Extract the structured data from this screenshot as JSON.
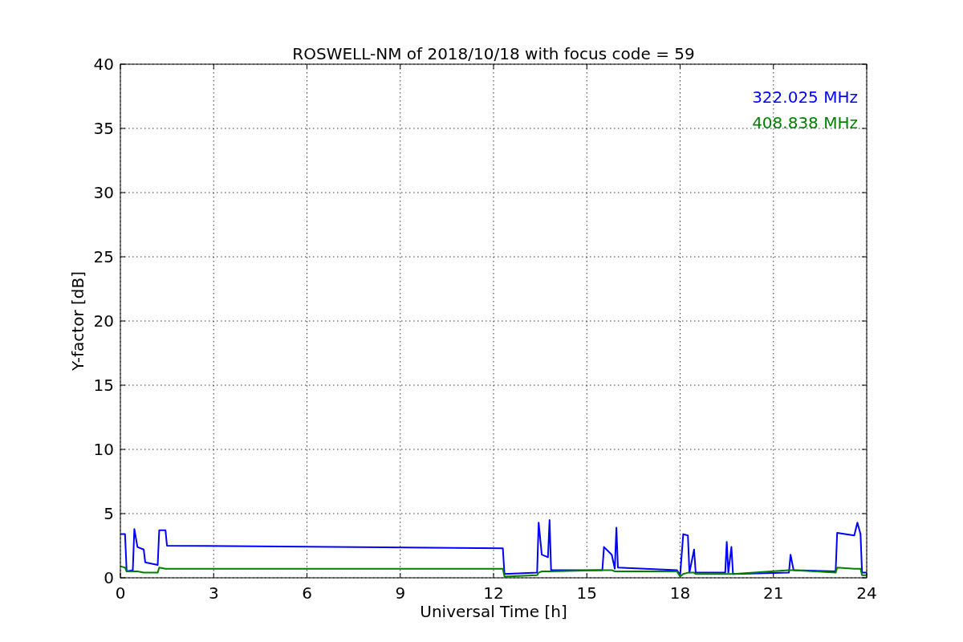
{
  "plot": {
    "chart_data": {
      "type": "line",
      "title": "ROSWELL-NM of 2018/10/18 with focus code = 59",
      "xlabel": "Universal Time [h]",
      "ylabel": "Y-factor [dB]",
      "x": [
        0,
        0.15,
        0.2,
        0.4,
        0.45,
        0.55,
        0.75,
        0.8,
        1.2,
        1.25,
        1.45,
        1.5,
        12.3,
        12.35,
        13.4,
        13.45,
        13.55,
        13.75,
        13.8,
        13.85,
        15.5,
        15.55,
        15.8,
        15.9,
        15.95,
        16.0,
        17.9,
        18.0,
        18.1,
        18.25,
        18.3,
        18.45,
        18.5,
        19.45,
        19.5,
        19.55,
        19.65,
        19.7,
        21.5,
        21.55,
        21.65,
        23.0,
        23.05,
        23.6,
        23.7,
        23.8,
        23.85,
        24
      ],
      "series": [
        {
          "name": "322.025 MHz",
          "color": "#0000ff",
          "values": [
            3.4,
            3.4,
            0.5,
            0.6,
            3.8,
            2.4,
            2.2,
            1.2,
            1.0,
            3.7,
            3.7,
            2.5,
            2.3,
            0.3,
            0.4,
            4.3,
            1.8,
            1.6,
            4.5,
            0.6,
            0.6,
            2.4,
            1.8,
            0.7,
            3.9,
            0.8,
            0.6,
            0.2,
            3.4,
            3.3,
            0.4,
            2.2,
            0.4,
            0.4,
            2.8,
            0.4,
            2.4,
            0.3,
            0.4,
            1.8,
            0.6,
            0.5,
            3.5,
            3.3,
            4.3,
            3.4,
            0.4,
            0.4
          ]
        },
        {
          "name": "408.838 MHz",
          "color": "#008000",
          "values": [
            0.9,
            0.8,
            0.5,
            0.5,
            0.5,
            0.5,
            0.4,
            0.4,
            0.4,
            0.8,
            0.7,
            0.7,
            0.7,
            0.1,
            0.2,
            0.4,
            0.5,
            0.5,
            0.5,
            0.5,
            0.6,
            0.6,
            0.6,
            0.5,
            0.5,
            0.5,
            0.5,
            0.1,
            0.3,
            0.4,
            0.4,
            0.4,
            0.3,
            0.3,
            0.3,
            0.3,
            0.3,
            0.3,
            0.6,
            0.6,
            0.6,
            0.4,
            0.8,
            0.7,
            0.7,
            0.7,
            0.2,
            0.2
          ]
        }
      ],
      "grid": true,
      "xlim": [
        0,
        24
      ],
      "ylim": [
        0,
        40
      ],
      "xticks": [
        0,
        3,
        6,
        9,
        12,
        15,
        18,
        21,
        24
      ],
      "yticks": [
        0,
        5,
        10,
        15,
        20,
        25,
        30,
        35,
        40
      ]
    }
  }
}
